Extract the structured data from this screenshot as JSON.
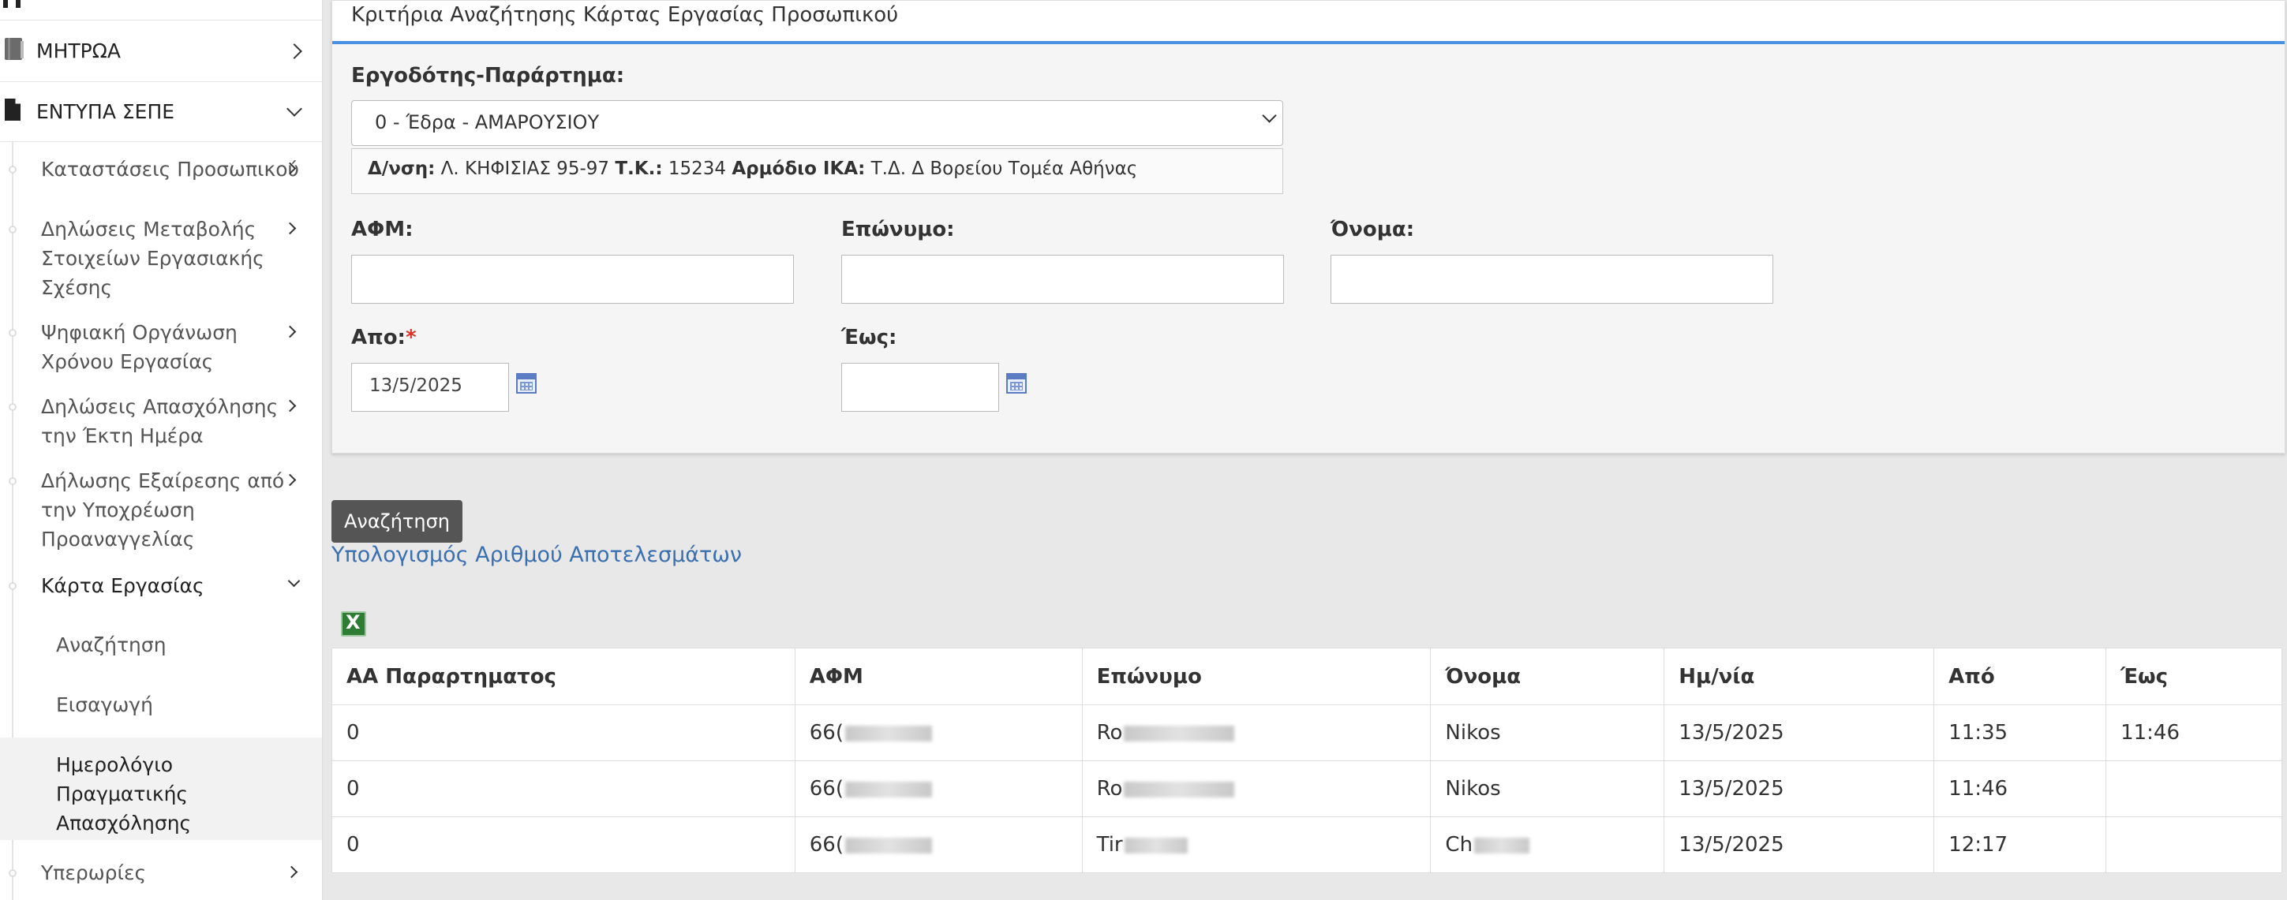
{
  "sidebar": {
    "main_items": [
      {
        "label": "ΜΗΤΡΩΑ",
        "icon": "book-icon"
      },
      {
        "label": "ΕΝΤΥΠΑ ΣΕΠΕ",
        "icon": "document-icon"
      }
    ],
    "sub_items": [
      {
        "label": "Καταστάσεις Προσωπικού"
      },
      {
        "label": "Δηλώσεις Μεταβολής Στοιχείων Εργασιακής Σχέσης"
      },
      {
        "label": "Ψηφιακή Οργάνωση Χρόνου Εργασίας"
      },
      {
        "label": "Δηλώσεις Απασχόλησης την Έκτη Ημέρα"
      },
      {
        "label": "Δήλωσης Εξαίρεσης από την Υποχρέωση Προαναγγελίας"
      },
      {
        "label": "Κάρτα Εργασίας"
      }
    ],
    "card_sub": [
      {
        "label": "Αναζήτηση"
      },
      {
        "label": "Εισαγωγή"
      },
      {
        "label": "Ημερολόγιο Πραγματικής Απασχόλησης"
      }
    ],
    "last_item": "Υπερωρίες"
  },
  "panel": {
    "title": "Κριτήρια Αναζήτησης Κάρτας Εργασίας Προσωπικού",
    "employer_label": "Εργοδότης-Παράρτημα:",
    "employer_value": "0 - Έδρα - ΑΜΑΡΟΥΣΙΟΥ",
    "info": {
      "addr_label": "Δ/νση:",
      "addr_value": "Λ. ΚΗΦΙΣΙΑΣ 95-97",
      "tk_label": "Τ.Κ.:",
      "tk_value": "15234",
      "ika_label": "Αρμόδιο ΙΚΑ:",
      "ika_value": "Τ.Δ. Δ Βορείου Τομέα Αθήνας"
    },
    "afm_label": "ΑΦΜ:",
    "surname_label": "Επώνυμο:",
    "name_label": "Όνομα:",
    "from_label": "Απο:",
    "required_mark": "*",
    "from_value": "13/5/2025",
    "to_label": "Έως:",
    "to_value": ""
  },
  "search_button": "Αναζήτηση",
  "count_link": "Υπολογισμός Αριθμού Αποτελεσμάτων",
  "export_icon_letter": "X",
  "table": {
    "headers": [
      "ΑΑ Παραρτηματος",
      "ΑΦΜ",
      "Επώνυμο",
      "Όνομα",
      "Ημ/νία",
      "Από",
      "Έως"
    ],
    "rows": [
      {
        "aa": "0",
        "afm": "66(",
        "surname": "Ro",
        "name": "Nikos",
        "date": "13/5/2025",
        "from": "11:35",
        "to": "11:46"
      },
      {
        "aa": "0",
        "afm": "66(",
        "surname": "Ro",
        "name": "Nikos",
        "date": "13/5/2025",
        "from": "11:46",
        "to": ""
      },
      {
        "aa": "0",
        "afm": "66(",
        "surname": "Tir",
        "name": "Ch",
        "date": "13/5/2025",
        "from": "12:17",
        "to": ""
      }
    ]
  }
}
